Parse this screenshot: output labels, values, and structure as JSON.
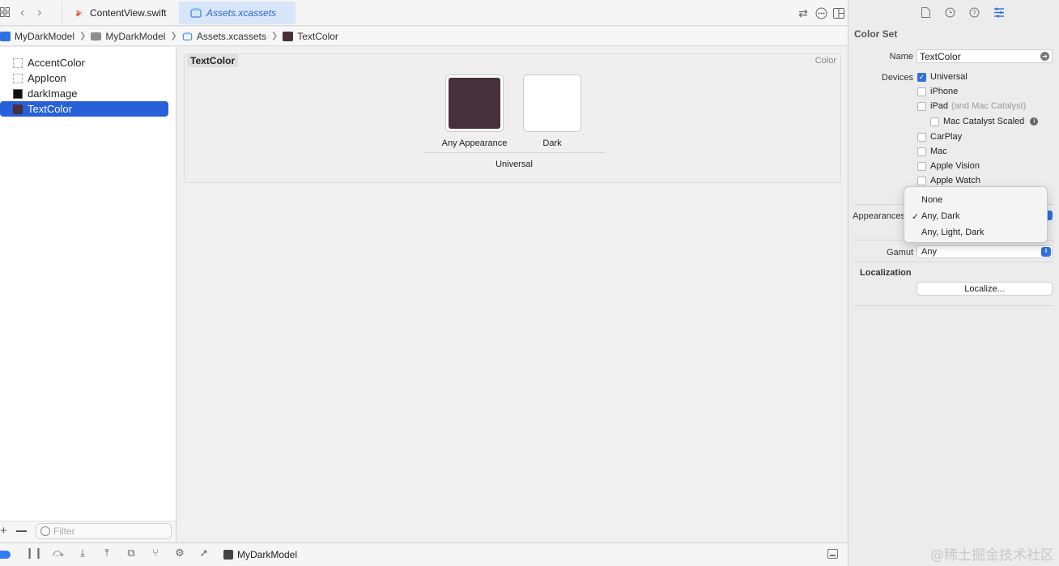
{
  "tabs": {
    "swift": "ContentView.swift",
    "assets": "Assets.xcassets"
  },
  "breadcrumb": {
    "project": "MyDarkModel",
    "group": "MyDarkModel",
    "catalog": "Assets.xcassets",
    "asset": "TextColor"
  },
  "navigator": {
    "items": [
      {
        "label": "AccentColor",
        "swatch": "empty"
      },
      {
        "label": "AppIcon",
        "swatch": "empty"
      },
      {
        "label": "darkImage",
        "swatch": "black"
      },
      {
        "label": "TextColor",
        "swatch": "#46303a",
        "selected": true
      }
    ],
    "filter_placeholder": "Filter"
  },
  "canvas": {
    "set_name": "TextColor",
    "set_kind": "Color",
    "wells": [
      {
        "label": "Any Appearance",
        "color": "#46303a"
      },
      {
        "label": "Dark",
        "color": "#ffffff"
      }
    ],
    "device_group": "Universal"
  },
  "bottombar": {
    "target": "MyDarkModel"
  },
  "inspector": {
    "section_title": "Color Set",
    "name_label": "Name",
    "name_value": "TextColor",
    "devices_label": "Devices",
    "devices": [
      {
        "label": "Universal",
        "checked": true
      },
      {
        "label": "iPhone",
        "checked": false
      },
      {
        "label": "iPad",
        "note": "(and Mac Catalyst)",
        "checked": false
      },
      {
        "label": "Mac Catalyst Scaled",
        "checked": false
      },
      {
        "label": "CarPlay",
        "checked": false
      },
      {
        "label": "Mac",
        "checked": false
      },
      {
        "label": "Apple Vision",
        "checked": false
      },
      {
        "label": "Apple Watch",
        "checked": false
      }
    ],
    "appearances_label": "Appearances",
    "gamut_label": "Gamut",
    "gamut_value": "Any",
    "localization_title": "Localization",
    "localize_button": "Localize..."
  },
  "popup": {
    "options": [
      {
        "label": "None",
        "checked": false
      },
      {
        "label": "Any, Dark",
        "checked": true
      },
      {
        "label": "Any, Light, Dark",
        "checked": false
      }
    ]
  },
  "watermark": "@稀土掘金技术社区",
  "colors": {
    "accent": "#2760d8",
    "text_color_swatch": "#46303a",
    "tab_active_bg": "#d8e6f9"
  }
}
